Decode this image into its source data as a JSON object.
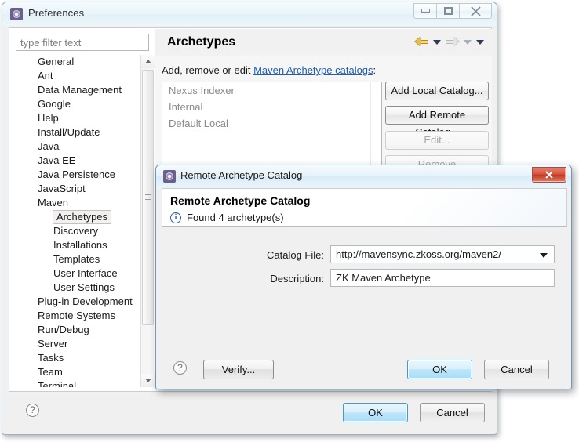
{
  "preferences_window": {
    "title": "Preferences",
    "icon": "gear-icon",
    "window_buttons": {
      "minimize": "minimize-icon",
      "maximize": "maximize-icon",
      "close": "close-icon"
    },
    "filter": {
      "placeholder": "type filter text",
      "value": ""
    },
    "tree": [
      {
        "label": "General",
        "level": 0,
        "selected": false
      },
      {
        "label": "Ant",
        "level": 0,
        "selected": false
      },
      {
        "label": "Data Management",
        "level": 0,
        "selected": false
      },
      {
        "label": "Google",
        "level": 0,
        "selected": false
      },
      {
        "label": "Help",
        "level": 0,
        "selected": false
      },
      {
        "label": "Install/Update",
        "level": 0,
        "selected": false
      },
      {
        "label": "Java",
        "level": 0,
        "selected": false
      },
      {
        "label": "Java EE",
        "level": 0,
        "selected": false
      },
      {
        "label": "Java Persistence",
        "level": 0,
        "selected": false
      },
      {
        "label": "JavaScript",
        "level": 0,
        "selected": false
      },
      {
        "label": "Maven",
        "level": 0,
        "selected": false
      },
      {
        "label": "Archetypes",
        "level": 1,
        "selected": true
      },
      {
        "label": "Discovery",
        "level": 1,
        "selected": false
      },
      {
        "label": "Installations",
        "level": 1,
        "selected": false
      },
      {
        "label": "Templates",
        "level": 1,
        "selected": false
      },
      {
        "label": "User Interface",
        "level": 1,
        "selected": false
      },
      {
        "label": "User Settings",
        "level": 1,
        "selected": false
      },
      {
        "label": "Plug-in Development",
        "level": 0,
        "selected": false
      },
      {
        "label": "Remote Systems",
        "level": 0,
        "selected": false
      },
      {
        "label": "Run/Debug",
        "level": 0,
        "selected": false
      },
      {
        "label": "Server",
        "level": 0,
        "selected": false
      },
      {
        "label": "Tasks",
        "level": 0,
        "selected": false
      },
      {
        "label": "Team",
        "level": 0,
        "selected": false
      },
      {
        "label": "Terminal",
        "level": 0,
        "selected": false
      }
    ],
    "pane": {
      "title": "Archetypes",
      "nav": {
        "back": "back-arrow-icon",
        "back_menu": "chevron-down-icon",
        "forward": "forward-arrow-icon",
        "forward_menu": "chevron-down-icon",
        "view_menu": "chevron-down-icon"
      },
      "description_prefix": "Add, remove or edit ",
      "description_link": "Maven Archetype catalogs",
      "description_suffix": ":",
      "catalogs": [
        "Nexus Indexer",
        "Internal",
        "Default Local"
      ],
      "buttons": {
        "add_local": "Add Local Catalog...",
        "add_remote": "Add Remote Catalog...",
        "edit": "Edit...",
        "remove": "Remove"
      }
    },
    "footer": {
      "help": "?",
      "ok": "OK",
      "cancel": "Cancel"
    }
  },
  "dialog": {
    "title": "Remote Archetype Catalog",
    "icon": "gear-icon",
    "close_label": "✕",
    "heading": "Remote Archetype Catalog",
    "info_icon": "info-icon",
    "info_text": "Found 4 archetype(s)",
    "fields": {
      "catalog_file_label": "Catalog File:",
      "catalog_file_value": "http://mavensync.zkoss.org/maven2/",
      "catalog_file_caret": "chevron-down-icon",
      "description_label": "Description:",
      "description_value": "ZK Maven Archetype"
    },
    "footer": {
      "help": "?",
      "verify": "Verify...",
      "ok": "OK",
      "cancel": "Cancel"
    }
  },
  "colors": {
    "accent_link": "#1c5fb5",
    "primary_button": "#a9ddf7",
    "close_button": "#c33a22",
    "back_arrow": "#e8bf4e",
    "info_icon": "#2c5f9e"
  }
}
